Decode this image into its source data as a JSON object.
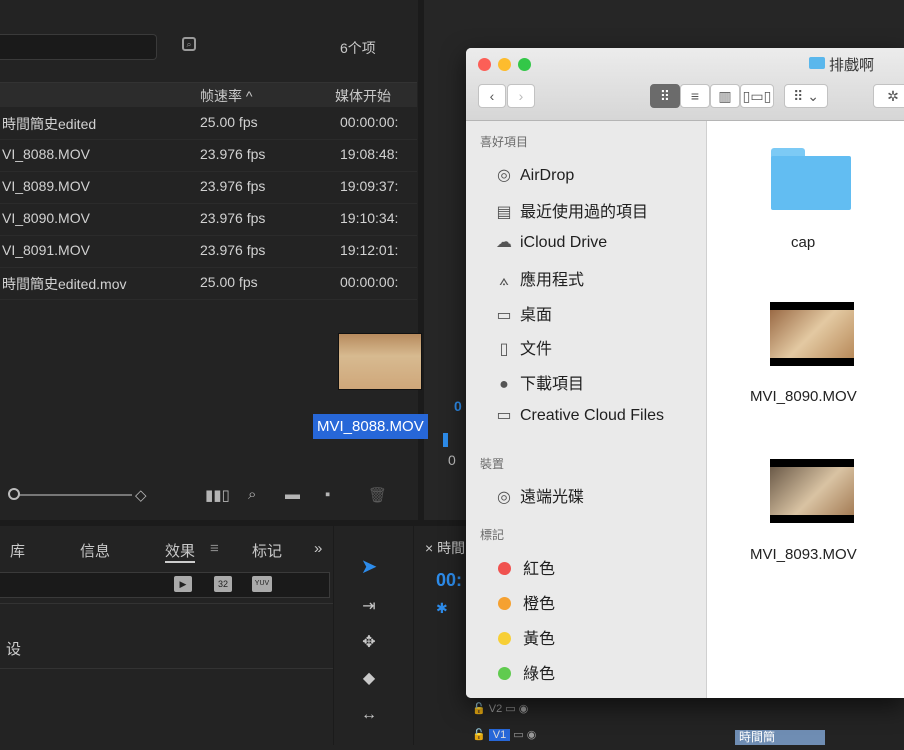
{
  "project": {
    "item_count": "6个项",
    "columns": {
      "framerate": "帧速率 ^",
      "media_start": "媒体开始"
    },
    "rows": [
      {
        "name": "時間簡史edited",
        "fps": "25.00 fps",
        "start": "00:00:00:"
      },
      {
        "name": "VI_8088.MOV",
        "fps": "23.976 fps",
        "start": "19:08:48:"
      },
      {
        "name": "VI_8089.MOV",
        "fps": "23.976 fps",
        "start": "19:09:37:"
      },
      {
        "name": "VI_8090.MOV",
        "fps": "23.976 fps",
        "start": "19:10:34:"
      },
      {
        "name": "VI_8091.MOV",
        "fps": "23.976 fps",
        "start": "19:12:01:"
      },
      {
        "name": "時間簡史edited.mov",
        "fps": "25.00 fps",
        "start": "00:00:00:"
      }
    ]
  },
  "drag": {
    "label": "MVI_8088.MOV"
  },
  "lower_tabs": {
    "library": "库",
    "info": "信息",
    "effects": "效果",
    "effects_menu": "≡",
    "markers": "标记",
    "overflow": "»"
  },
  "effects": {
    "item": "设",
    "badges": [
      "32",
      "YUV"
    ]
  },
  "timeline": {
    "tab": "× 時間",
    "timecode": "00:",
    "tracks": [
      "V2",
      "V1"
    ],
    "clip": "時間簡"
  },
  "monitor": {
    "digit1": "0",
    "digit2": "0"
  },
  "finder": {
    "title": "排戲啊",
    "sidebar": {
      "favorites_header": "喜好項目",
      "favorites": [
        {
          "icon": "airdrop-icon",
          "glyph": "◎",
          "label": "AirDrop"
        },
        {
          "icon": "recents-icon",
          "glyph": "▤",
          "label": "最近使用過的項目"
        },
        {
          "icon": "icloud-icon",
          "glyph": "☁",
          "label": "iCloud Drive"
        },
        {
          "icon": "applications-icon",
          "glyph": "⟑",
          "label": "應用程式"
        },
        {
          "icon": "desktop-icon",
          "glyph": "▭",
          "label": "桌面"
        },
        {
          "icon": "documents-icon",
          "glyph": "▯",
          "label": "文件"
        },
        {
          "icon": "downloads-icon",
          "glyph": "●",
          "label": "下載項目"
        },
        {
          "icon": "folder-icon",
          "glyph": "▭",
          "label": "Creative Cloud Files"
        }
      ],
      "devices_header": "裝置",
      "devices": [
        {
          "icon": "disc-icon",
          "glyph": "◎",
          "label": "遠端光碟"
        }
      ],
      "tags_header": "標記",
      "tags": [
        {
          "label": "紅色",
          "color": "#f0524f"
        },
        {
          "label": "橙色",
          "color": "#f5a131"
        },
        {
          "label": "黃色",
          "color": "#f7cf36"
        },
        {
          "label": "綠色",
          "color": "#60cb4f"
        }
      ]
    },
    "files": [
      {
        "name": "cap",
        "kind": "folder"
      },
      {
        "name": "MVI_8090.MOV",
        "kind": "video"
      },
      {
        "name": "MVI_8093.MOV",
        "kind": "video"
      }
    ]
  }
}
